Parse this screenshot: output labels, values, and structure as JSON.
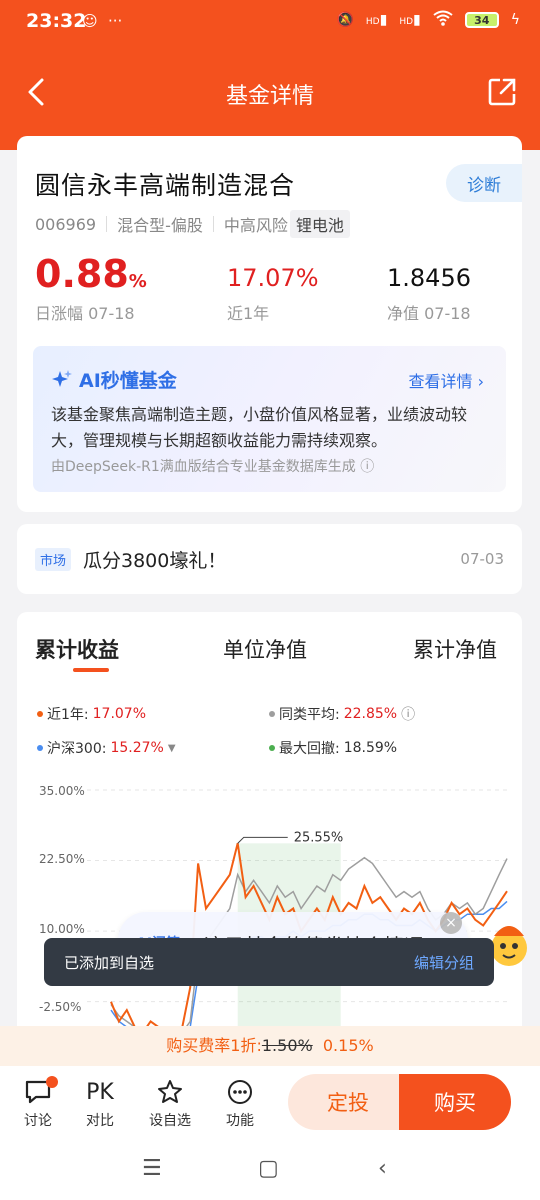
{
  "status_bar": {
    "time": "23:32",
    "battery": "34",
    "hd1": "HD",
    "hd2": "HD"
  },
  "header": {
    "title": "基金详情"
  },
  "fund": {
    "name": "圆信永丰高端制造混合",
    "diagnose_label": "诊断",
    "code": "006969",
    "type": "混合型-偏股",
    "risk": "中高风险",
    "theme_tag": "锂电池",
    "daily_change": "0.88",
    "daily_change_unit": "%",
    "daily_change_label": "日涨幅 07-18",
    "one_year": "17.07%",
    "one_year_label": "近1年",
    "nav": "1.8456",
    "nav_label": "净值 07-18"
  },
  "ai": {
    "title": "AI秒懂基金",
    "more": "查看详情 ›",
    "summary": "该基金聚焦高端制造主题，小盘价值风格显著，业绩波动较大，管理规模与长期超额收益能力需持续观察。",
    "source": "由DeepSeek-R1满血版结合专业基金数据库生成 ⓘ"
  },
  "news": {
    "tag": "市场",
    "text": "瓜分3800壕礼！",
    "date": "07-03"
  },
  "chart_tabs": [
    "累计收益",
    "单位净值",
    "累计净值"
  ],
  "legend": {
    "one_year_label": "近1年:",
    "one_year_value": "17.07%",
    "peer_label": "同类平均:",
    "peer_value": "22.85%",
    "hs300_label": "沪深300:",
    "hs300_value": "15.27%",
    "drawdown_label": "最大回撤:",
    "drawdown_value": "18.59%"
  },
  "colors": {
    "fund": "#f25f13",
    "peer": "#9e9e9e",
    "hs300": "#4a8df0",
    "drawdown": "#4caf50",
    "accent": "#f4511e"
  },
  "chart_data": {
    "type": "line",
    "ylim": [
      -10,
      35
    ],
    "yticks": [
      "35.00%",
      "22.50%",
      "10.00%",
      "-2.50%"
    ],
    "annotation": "25.55%",
    "series": [
      {
        "values": [
          -2.5,
          -6,
          -4,
          -7,
          -8,
          -6,
          -7,
          -7.5,
          -8,
          -7,
          0,
          22,
          14,
          16,
          18,
          20,
          25.55,
          16,
          18,
          15,
          12,
          16,
          13,
          14,
          10,
          12,
          14,
          12,
          16,
          13,
          15,
          14,
          18,
          15,
          16,
          14,
          12,
          14,
          13,
          15,
          12,
          10,
          12,
          15,
          13,
          14,
          12,
          11,
          13,
          15,
          17.07
        ]
      },
      {
        "values": [
          -3,
          -5,
          -6,
          -7,
          -8,
          -7,
          -7,
          -8,
          -8,
          -8,
          -6,
          6,
          8,
          10,
          12,
          14,
          20,
          17,
          19,
          17,
          15,
          18,
          16,
          17,
          14,
          16,
          18,
          17,
          20,
          19,
          21,
          22,
          23,
          22,
          20,
          18,
          16,
          17,
          16,
          17,
          14,
          12,
          13,
          15,
          14,
          15,
          13,
          14,
          17,
          20,
          22.85
        ]
      },
      {
        "values": [
          -4,
          -6,
          -7,
          -8,
          -8,
          -8,
          -8,
          -8,
          -8,
          -8,
          -7,
          2,
          4,
          5,
          6,
          7,
          8,
          8,
          9,
          9,
          8,
          9,
          9,
          10,
          9,
          10,
          10,
          10,
          11,
          11,
          12,
          12,
          13,
          13,
          12,
          12,
          11,
          11,
          11,
          12,
          11,
          10,
          11,
          12,
          12,
          13,
          13,
          13,
          14,
          14,
          15.27
        ]
      }
    ]
  },
  "promo": {
    "badge": "AI问答",
    "text": "这只基金的债券持仓情况",
    "close": "×"
  },
  "toast": {
    "message": "已添加到自选",
    "action": "编辑分组"
  },
  "fee": {
    "prefix": "购买费率1折:",
    "old": "1.50%",
    "new": "0.15%"
  },
  "bottom": {
    "discuss": "讨论",
    "pk_icon": "PK",
    "compare": "对比",
    "watch": "设自选",
    "function": "功能",
    "fixed_invest": "定投",
    "buy": "购买"
  }
}
